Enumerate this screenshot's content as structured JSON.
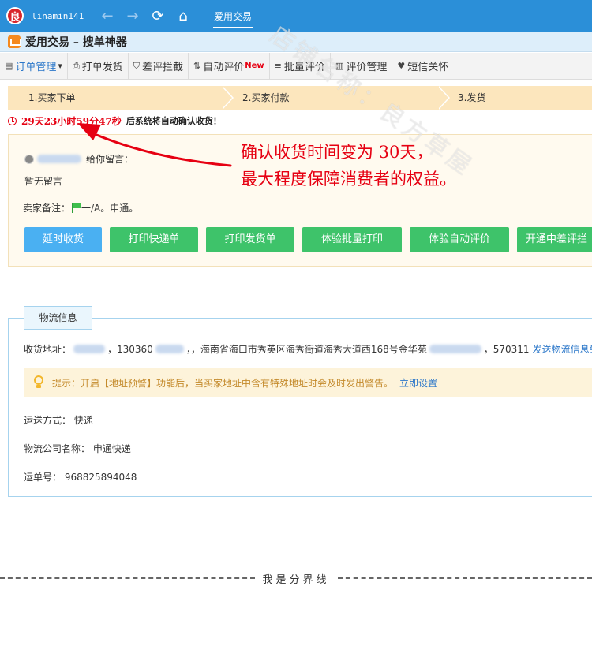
{
  "titlebar": {
    "logo_char": "良",
    "username": "linamin141",
    "back_icon": "←",
    "forward_icon": "→",
    "refresh_icon": "⟳",
    "home_icon": "⌂",
    "active_tab": "爱用交易"
  },
  "appbar": {
    "title": "爱用交易 – 搜单神器"
  },
  "menu": {
    "items": [
      {
        "icon": "▤",
        "label": "订单管理",
        "suffix": "▾"
      },
      {
        "icon": "⎙",
        "label": "打单发货"
      },
      {
        "icon": "⛉",
        "label": "差评拦截"
      },
      {
        "icon": "⇅",
        "label": "自动评价",
        "badge": "New"
      },
      {
        "icon": "≡",
        "label": "批量评价"
      },
      {
        "icon": "▥",
        "label": "评价管理"
      },
      {
        "icon": "♥",
        "label": "短信关怀"
      }
    ]
  },
  "steps": [
    "1.买家下单",
    "2.买家付款",
    "3.发货"
  ],
  "countdown": {
    "time": "29天23小时59分47秒",
    "text": "后系统将自动确认收货！"
  },
  "order": {
    "leave_message_label": "给你留言：",
    "no_message": "暂无留言",
    "seller_note_label": "卖家备注：",
    "seller_note_value": "一/A。申通。",
    "buttons": [
      {
        "label": "延时收货",
        "color": "#4ab0f2"
      },
      {
        "label": "打印快递单",
        "color": "#3ec36a"
      },
      {
        "label": "打印发货单",
        "color": "#3ec36a"
      },
      {
        "label": "体验批量打印",
        "color": "#3ec36a"
      },
      {
        "label": "体验自动评价",
        "color": "#3ec36a"
      },
      {
        "label": "开通中差评拦",
        "color": "#3ec36a"
      }
    ]
  },
  "annotation": {
    "line1": "确认收货时间变为 30天，",
    "line2": "最大程度保障消费者的权益。",
    "color": "#e60012"
  },
  "watermark": "店铺名称：良方草屋",
  "logistics": {
    "tab_label": "物流信息",
    "address_label": "收货地址：",
    "phone_prefix": "，130360",
    "address_mid": "，，海南省海口市秀英区海秀街道海秀大道西168号金华苑",
    "zip": "，570311",
    "address_link": "发送物流信息到旺",
    "tip_text": "提示：开启【地址预警】功能后，当买家地址中含有特殊地址时会及时发出警告。",
    "tip_link": "立即设置",
    "shipping_method": "运送方式： 快递",
    "carrier": "物流公司名称： 申通快递",
    "tracking": "运单号： 968825894048"
  },
  "divider_text": "我是分界线"
}
